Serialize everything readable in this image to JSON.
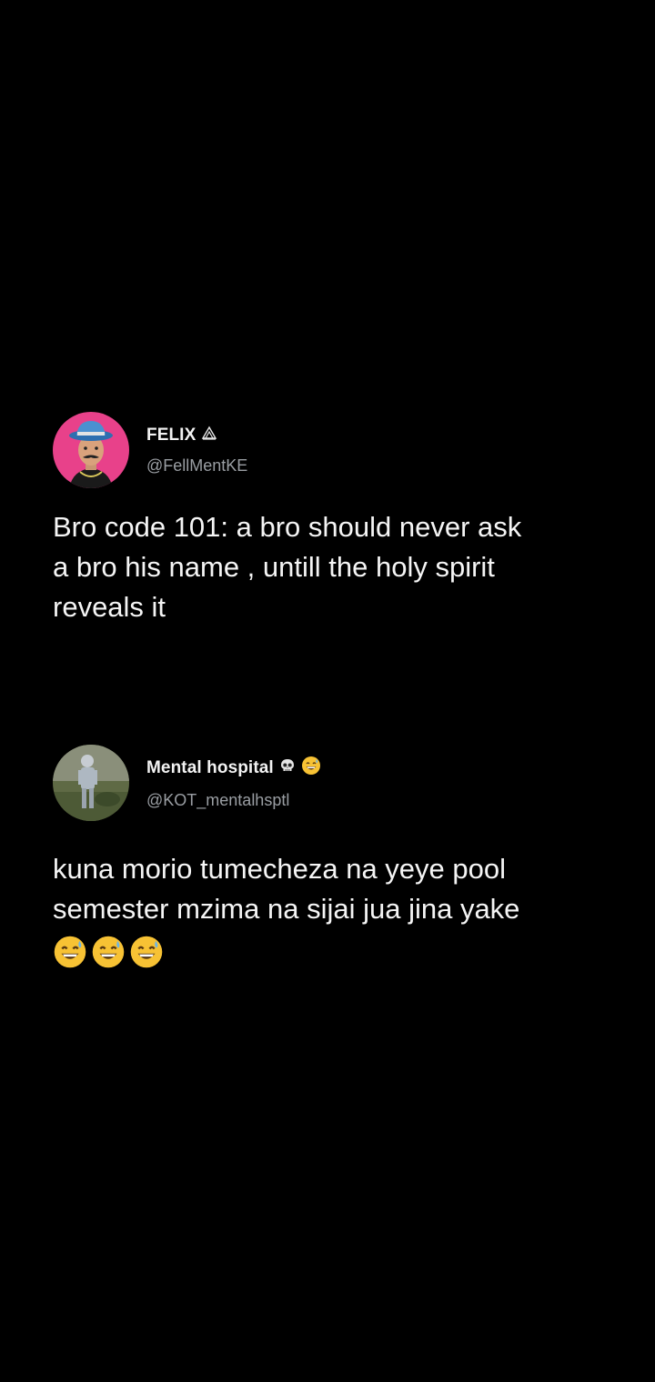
{
  "tweets": [
    {
      "display_name": "FELIX",
      "name_badge_icon": "ovo-owl-icon",
      "handle": "@FellMentKE",
      "text": "Bro code 101: a bro should never ask\na bro his name , untill the holy spirit\nreveals it",
      "avatar_bg": "#e8418a"
    },
    {
      "display_name": "Mental hospital",
      "name_emojis": [
        "skull-icon",
        "grinning-sweat-face-icon"
      ],
      "handle": "@KOT_mentalhsptl",
      "text": "kuna morio tumecheza na yeye pool\nsemester mzima na sijai jua jina yake",
      "trailing_emojis": [
        "grinning-sweat-face-icon",
        "grinning-sweat-face-icon",
        "grinning-sweat-face-icon"
      ]
    }
  ],
  "colors": {
    "background": "#000000",
    "text": "#f5f5f5",
    "handle": "#9a9ea3"
  }
}
